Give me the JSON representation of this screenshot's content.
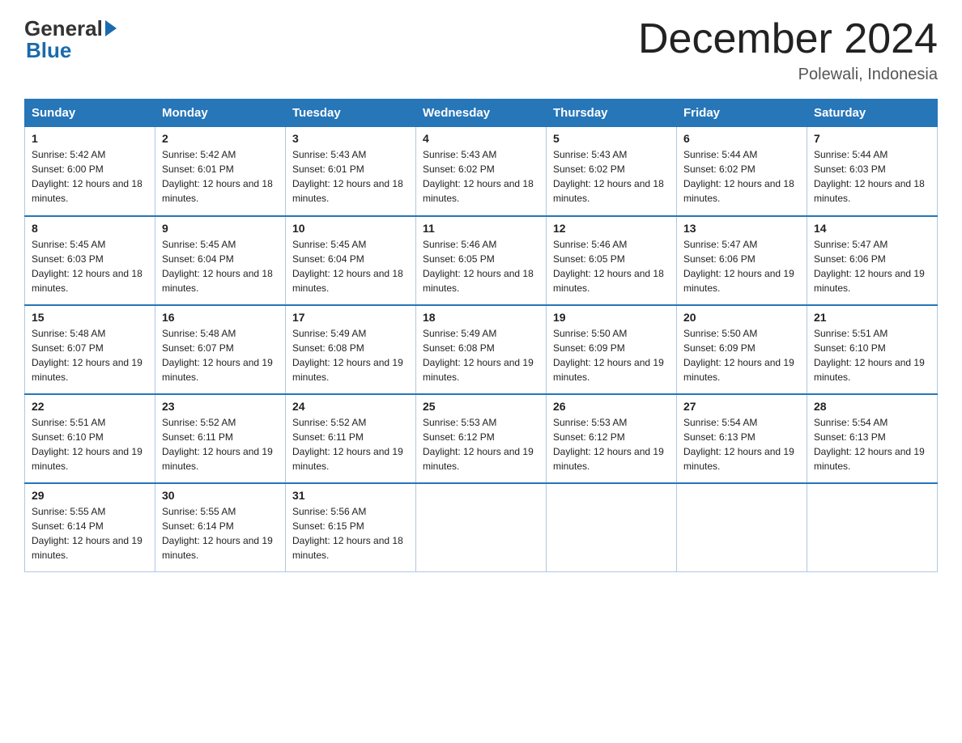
{
  "header": {
    "logo_general": "General",
    "logo_blue": "Blue",
    "title": "December 2024",
    "location": "Polewali, Indonesia"
  },
  "days_header": [
    "Sunday",
    "Monday",
    "Tuesday",
    "Wednesday",
    "Thursday",
    "Friday",
    "Saturday"
  ],
  "weeks": [
    [
      {
        "day": "1",
        "sunrise": "5:42 AM",
        "sunset": "6:00 PM",
        "daylight": "12 hours and 18 minutes."
      },
      {
        "day": "2",
        "sunrise": "5:42 AM",
        "sunset": "6:01 PM",
        "daylight": "12 hours and 18 minutes."
      },
      {
        "day": "3",
        "sunrise": "5:43 AM",
        "sunset": "6:01 PM",
        "daylight": "12 hours and 18 minutes."
      },
      {
        "day": "4",
        "sunrise": "5:43 AM",
        "sunset": "6:02 PM",
        "daylight": "12 hours and 18 minutes."
      },
      {
        "day": "5",
        "sunrise": "5:43 AM",
        "sunset": "6:02 PM",
        "daylight": "12 hours and 18 minutes."
      },
      {
        "day": "6",
        "sunrise": "5:44 AM",
        "sunset": "6:02 PM",
        "daylight": "12 hours and 18 minutes."
      },
      {
        "day": "7",
        "sunrise": "5:44 AM",
        "sunset": "6:03 PM",
        "daylight": "12 hours and 18 minutes."
      }
    ],
    [
      {
        "day": "8",
        "sunrise": "5:45 AM",
        "sunset": "6:03 PM",
        "daylight": "12 hours and 18 minutes."
      },
      {
        "day": "9",
        "sunrise": "5:45 AM",
        "sunset": "6:04 PM",
        "daylight": "12 hours and 18 minutes."
      },
      {
        "day": "10",
        "sunrise": "5:45 AM",
        "sunset": "6:04 PM",
        "daylight": "12 hours and 18 minutes."
      },
      {
        "day": "11",
        "sunrise": "5:46 AM",
        "sunset": "6:05 PM",
        "daylight": "12 hours and 18 minutes."
      },
      {
        "day": "12",
        "sunrise": "5:46 AM",
        "sunset": "6:05 PM",
        "daylight": "12 hours and 18 minutes."
      },
      {
        "day": "13",
        "sunrise": "5:47 AM",
        "sunset": "6:06 PM",
        "daylight": "12 hours and 19 minutes."
      },
      {
        "day": "14",
        "sunrise": "5:47 AM",
        "sunset": "6:06 PM",
        "daylight": "12 hours and 19 minutes."
      }
    ],
    [
      {
        "day": "15",
        "sunrise": "5:48 AM",
        "sunset": "6:07 PM",
        "daylight": "12 hours and 19 minutes."
      },
      {
        "day": "16",
        "sunrise": "5:48 AM",
        "sunset": "6:07 PM",
        "daylight": "12 hours and 19 minutes."
      },
      {
        "day": "17",
        "sunrise": "5:49 AM",
        "sunset": "6:08 PM",
        "daylight": "12 hours and 19 minutes."
      },
      {
        "day": "18",
        "sunrise": "5:49 AM",
        "sunset": "6:08 PM",
        "daylight": "12 hours and 19 minutes."
      },
      {
        "day": "19",
        "sunrise": "5:50 AM",
        "sunset": "6:09 PM",
        "daylight": "12 hours and 19 minutes."
      },
      {
        "day": "20",
        "sunrise": "5:50 AM",
        "sunset": "6:09 PM",
        "daylight": "12 hours and 19 minutes."
      },
      {
        "day": "21",
        "sunrise": "5:51 AM",
        "sunset": "6:10 PM",
        "daylight": "12 hours and 19 minutes."
      }
    ],
    [
      {
        "day": "22",
        "sunrise": "5:51 AM",
        "sunset": "6:10 PM",
        "daylight": "12 hours and 19 minutes."
      },
      {
        "day": "23",
        "sunrise": "5:52 AM",
        "sunset": "6:11 PM",
        "daylight": "12 hours and 19 minutes."
      },
      {
        "day": "24",
        "sunrise": "5:52 AM",
        "sunset": "6:11 PM",
        "daylight": "12 hours and 19 minutes."
      },
      {
        "day": "25",
        "sunrise": "5:53 AM",
        "sunset": "6:12 PM",
        "daylight": "12 hours and 19 minutes."
      },
      {
        "day": "26",
        "sunrise": "5:53 AM",
        "sunset": "6:12 PM",
        "daylight": "12 hours and 19 minutes."
      },
      {
        "day": "27",
        "sunrise": "5:54 AM",
        "sunset": "6:13 PM",
        "daylight": "12 hours and 19 minutes."
      },
      {
        "day": "28",
        "sunrise": "5:54 AM",
        "sunset": "6:13 PM",
        "daylight": "12 hours and 19 minutes."
      }
    ],
    [
      {
        "day": "29",
        "sunrise": "5:55 AM",
        "sunset": "6:14 PM",
        "daylight": "12 hours and 19 minutes."
      },
      {
        "day": "30",
        "sunrise": "5:55 AM",
        "sunset": "6:14 PM",
        "daylight": "12 hours and 19 minutes."
      },
      {
        "day": "31",
        "sunrise": "5:56 AM",
        "sunset": "6:15 PM",
        "daylight": "12 hours and 18 minutes."
      },
      null,
      null,
      null,
      null
    ]
  ]
}
